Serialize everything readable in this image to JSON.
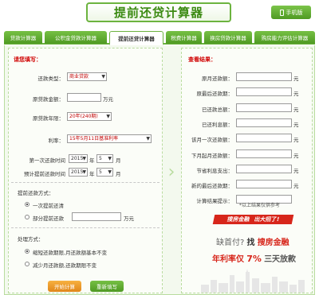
{
  "header": {
    "title": "提前还贷计算器",
    "mobile_label": "手机版"
  },
  "tabs": [
    {
      "label": "贷款计算器",
      "active": false
    },
    {
      "label": "公积金贷款计算器",
      "active": false
    },
    {
      "label": "提前还贷计算器",
      "active": true
    },
    {
      "label": "税费计算器",
      "active": false
    },
    {
      "label": "换房贷款计算器",
      "active": false
    },
    {
      "label": "购房能力评估计算器",
      "active": false
    }
  ],
  "form": {
    "section_title": "请您填写：",
    "loan_type": {
      "label": "还款类型：",
      "value": "商业贷款"
    },
    "original_amount": {
      "label": "原贷款金额：",
      "value": "",
      "unit": "万元"
    },
    "original_term": {
      "label": "原贷款年限：",
      "value": "20年(240期)"
    },
    "rate": {
      "label": "利率：",
      "value": "15年5月11日基准利率"
    },
    "first_repay_time": {
      "label": "第一次还款时间",
      "year": "2015",
      "year_unit": "年",
      "month": "5",
      "month_unit": "月"
    },
    "planned_prepay_time": {
      "label": "预计提前还款时间",
      "year": "2015",
      "year_unit": "年",
      "month": "5",
      "month_unit": "月"
    },
    "prepay_method": {
      "label": "提前还款方式：",
      "option_full": "一次提前还清",
      "option_partial": "部分提前还款",
      "partial_unit": "万元"
    },
    "handling": {
      "label": "处理方式：",
      "option_a": "缩短还款期限,月还款额基本不变",
      "option_b": "减少月还款额,还款期限不变"
    },
    "start_button": "开始计算",
    "reset_button": "重新填写"
  },
  "results": {
    "section_title": "查看结果：",
    "unit": "元",
    "rows": [
      {
        "label": "原月还款额："
      },
      {
        "label": "原最后还款期："
      },
      {
        "label": "已还款总额："
      },
      {
        "label": "已还利息额："
      },
      {
        "label": "该月一次还款额："
      },
      {
        "label": "下月起月还款额："
      },
      {
        "label": "节省利息支出："
      },
      {
        "label": "新的最后还款期："
      },
      {
        "label": "计算结果提示："
      }
    ],
    "note": "*以上结果仅供参考"
  },
  "ad": {
    "banner_brand": "搜房金融",
    "banner_slogan": "出大招了!",
    "line1_a": "缺首付?",
    "line1_b": "找",
    "line1_brand": "搜房金融",
    "line2_a": "年利率仅",
    "line2_rate": "7%",
    "line2_b": "三天放款"
  },
  "colors": {
    "brand_green": "#6cb33f",
    "alert_red": "#d00000",
    "ad_red": "#d7261b",
    "button_orange": "#e0861a"
  }
}
